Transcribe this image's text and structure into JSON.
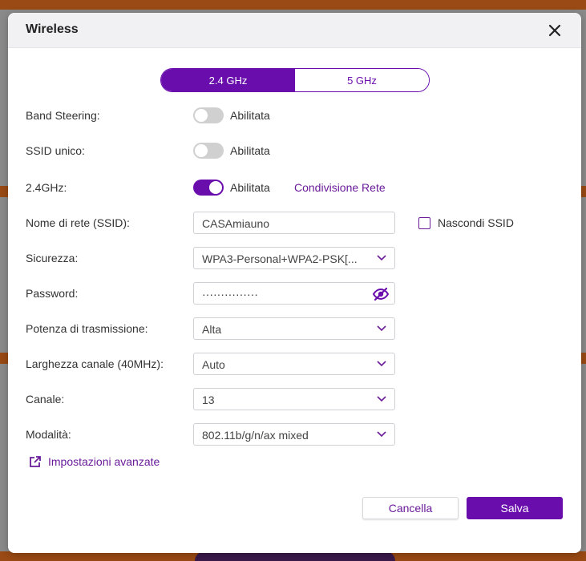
{
  "modal": {
    "title": "Wireless",
    "close_icon": "close-icon"
  },
  "band_tabs": [
    {
      "label": "2.4 GHz",
      "active": true
    },
    {
      "label": "5 GHz",
      "active": false
    }
  ],
  "rows": {
    "band_steering": {
      "label": "Band Steering:",
      "state": "off",
      "state_label": "Abilitata"
    },
    "ssid_unico": {
      "label": "SSID unico:",
      "state": "off",
      "state_label": "Abilitata"
    },
    "radio_24": {
      "label": "2.4GHz:",
      "state": "on",
      "state_label": "Abilitata",
      "link": "Condivisione Rete"
    },
    "ssid": {
      "label": "Nome di rete (SSID):",
      "value": "CASAmiauno",
      "hide_label": "Nascondi SSID",
      "hide_checked": false
    },
    "security": {
      "label": "Sicurezza:",
      "value": "WPA3-Personal+WPA2-PSK[..."
    },
    "password": {
      "label": "Password:",
      "value": "···············",
      "eye_icon": "eye-slash-icon"
    },
    "tx_power": {
      "label": "Potenza di trasmissione:",
      "value": "Alta"
    },
    "channel_width": {
      "label": "Larghezza canale (40MHz):",
      "value": "Auto"
    },
    "channel": {
      "label": "Canale:",
      "value": "13"
    },
    "mode": {
      "label": "Modalità:",
      "value": "802.11b/g/n/ax mixed"
    }
  },
  "advanced": {
    "label": "Impostazioni avanzate",
    "icon": "external-link-icon"
  },
  "buttons": {
    "cancel": "Cancella",
    "save": "Salva"
  },
  "colors": {
    "accent": "#6a0dad",
    "link": "#6a1b9a",
    "toggle_off": "#d0d0d0"
  }
}
